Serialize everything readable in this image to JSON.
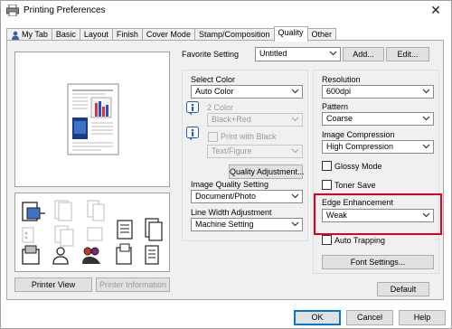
{
  "window": {
    "title": "Printing Preferences"
  },
  "tabs": [
    {
      "label": "My Tab"
    },
    {
      "label": "Basic"
    },
    {
      "label": "Layout"
    },
    {
      "label": "Finish"
    },
    {
      "label": "Cover Mode"
    },
    {
      "label": "Stamp/Composition"
    },
    {
      "label": "Quality"
    },
    {
      "label": "Other"
    }
  ],
  "favorite": {
    "label": "Favorite Setting",
    "value": "Untitled",
    "add_label": "Add...",
    "edit_label": "Edit..."
  },
  "left": {
    "printer_view_label": "Printer View",
    "printer_info_label": "Printer Information"
  },
  "color": {
    "select_color_label": "Select Color",
    "select_color_value": "Auto Color",
    "two_color_label": "2 Color",
    "two_color_value": "Black+Red",
    "print_with_black_label": "Print with Black",
    "text_figure_value": "Text/Figure",
    "quality_adjust_label": "Quality Adjustment..."
  },
  "image_quality": {
    "label": "Image Quality Setting",
    "value": "Document/Photo"
  },
  "line_width": {
    "label": "Line Width Adjustment",
    "value": "Machine Setting"
  },
  "right": {
    "resolution_label": "Resolution",
    "resolution_value": "600dpi",
    "pattern_label": "Pattern",
    "pattern_value": "Coarse",
    "image_compression_label": "Image Compression",
    "image_compression_value": "High Compression",
    "glossy_mode_label": "Glossy Mode",
    "toner_save_label": "Toner Save",
    "edge_enhancement_label": "Edge Enhancement",
    "edge_enhancement_value": "Weak",
    "auto_trapping_label": "Auto Trapping",
    "font_settings_label": "Font Settings..."
  },
  "default_label": "Default",
  "footer": {
    "ok_label": "OK",
    "cancel_label": "Cancel",
    "help_label": "Help"
  },
  "colors": {
    "highlight": "#e0001b",
    "focus": "#0078d7",
    "panel": "#f0f0f0"
  }
}
